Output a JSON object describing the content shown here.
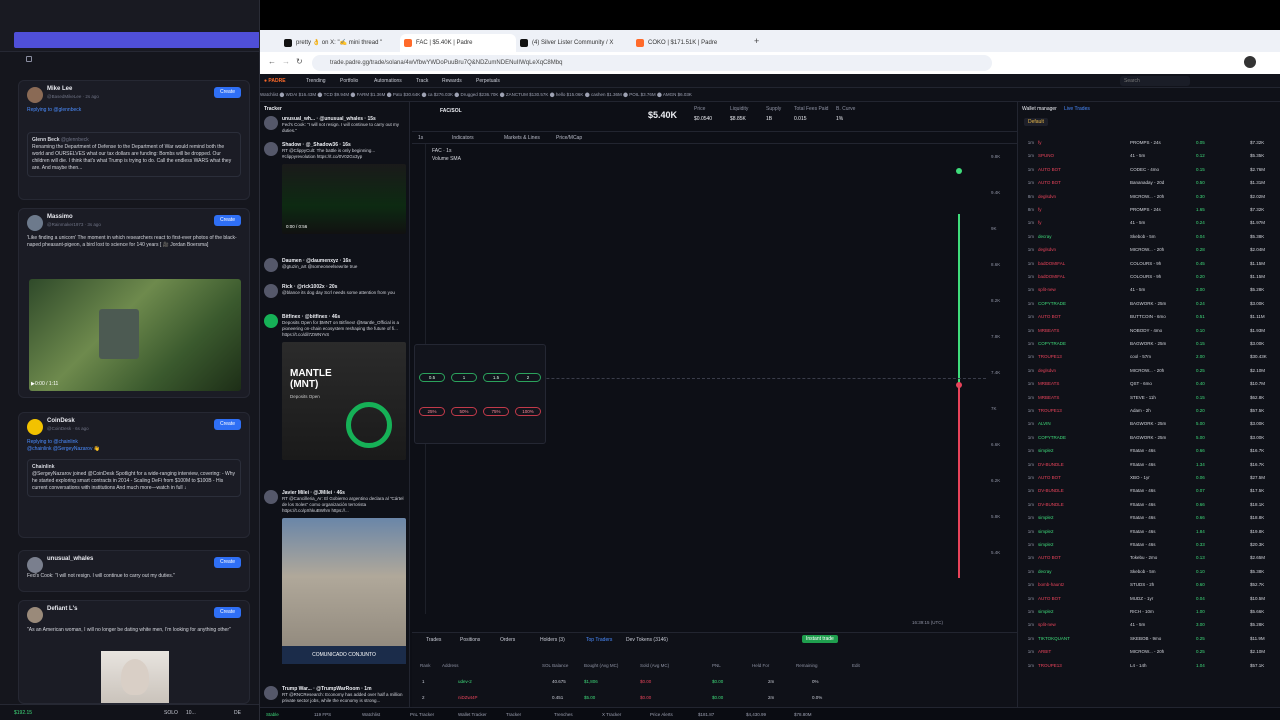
{
  "extension": {
    "posts": [
      {
        "name": "Mike Lee",
        "handle": "@BasedMikeLee · 2s ago",
        "reply": "Replying to @glennbeck",
        "quote_name": "Glenn Beck",
        "quote_handle": "@glennbeck",
        "quote_text": "Renaming the Department of Defense to the Department of War would remind both the world and OURSELVES what our tax dollars are funding: Bombs will be dropped. Our children will die. I think that's what Trump is trying to do. Call the endless WARS what they are. And maybe then..."
      },
      {
        "name": "Massimo",
        "handle": "@Rainmaker1973 · 3s ago",
        "text": "'Like finding a unicorn' The moment in which researchers react to first-ever photos of the black-naped pheasant-pigeon, a bird lost to science for 140 years [ 🎥 Jordan Boersma]",
        "video_time": "0:00 / 1:11"
      },
      {
        "name": "CoinDesk",
        "handle": "@CoinDesk · 6s ago",
        "reply": "Replying to @chainlink",
        "mention": "@chainlink @SergeyNazarov 👋",
        "quote_name": "Chainlink",
        "quote_text": "@SergeyNazarov joined @CoinDesk Spotlight for a wide-ranging interview, covering: - Why he started exploring smart contracts in 2014 - Scaling DeFi from $100M to $100B - His current conversations with institutions And much more—watch in full ↓"
      },
      {
        "name": "unusual_whales",
        "handle": "@unusual_whales · 8s ago",
        "text": "Fed's Cook: \"I will not resign. I will continue to carry out my duties.\""
      },
      {
        "name": "Defiant L's",
        "handle": "@DefiantLs · 9s ago",
        "text": "\"As an American woman, I will no longer be dating white men, I'm looking for anything other\""
      }
    ],
    "create_label": "Create",
    "footer": {
      "balance": "$192.15",
      "sol": "SOLO",
      "amount": "10...",
      "lang": "DE"
    }
  },
  "browser": {
    "tabs": [
      {
        "title": "pretty 👌 on X: \"✍️ mini thread \"",
        "color": "#111111"
      },
      {
        "title": "FAC | $5.40K | Padre",
        "color": "#ff6a2a"
      },
      {
        "title": "(4) Silver Lister Community / X",
        "color": "#111111"
      },
      {
        "title": "COKO | $171.51K | Padre",
        "color": "#ff6a2a"
      }
    ],
    "url": "trade.padre.gg/trade/solana/4wVfbwYWDoPuuBru7Q&NDZumNDENuIIWqLeXqC8Mbq"
  },
  "app": {
    "nav": [
      "Trending",
      "Portfolio",
      "Automations",
      "Track",
      "Rewards",
      "Perpetuals"
    ],
    "search_placeholder": "Search",
    "ticker": "Watchlist  ⬤ WDAI $16.43M  ⬤ TCD $9.94M  ⬤ FARM $1.36M  ⬤ Pato $30.64K  ⬤ ca $276.03K  ⬤ Drugged $236.70K  ⬤ ZANCTUM $130.57K  ⬤ hello $15.06K  ⬤ cashen $1.36M  ⬤ POIL $3.76M  ⬤ AMGN $6.03K",
    "tracker_title": "Tracker",
    "tweets": [
      {
        "name": "unusual_wh... · @unusual_whales · 15s",
        "text": "Fed's Cook: \"I will not resign. I will continue to carry out my duties.\""
      },
      {
        "name": "Shadow · @_Shadow36 · 16s",
        "text": "RT @ClippyCult: The battle is only beginning... #clippyrevolution https://t.co/0V02Gx3yp",
        "video": "0:00 / 0:56"
      },
      {
        "name": "Daumen · @daumenxyz · 16s",
        "text": "@gtuzin_art @someoneelsewrite true"
      },
      {
        "name": "Rick · @rick1002x · 20s",
        "text": "@blance its dog day Scrl needs some attention from you"
      },
      {
        "name": "Bitfinex · @bitfinex · 46s",
        "text": "Deposits Open for $MNT on Bitfinex! @Mantle_Official is a pioneering on-chain ecosystem reshaping the future of fi... https://t.co/dil7ZWNYvS",
        "image_text": "MANTLE (MNT)",
        "image_sub": "Deposits Open"
      },
      {
        "name": "Javier Milei · @JMilei · 46s",
        "text": "RT @Cancilleria_Ar: El Gobierno argentino declara al \"Cártel de los Soles\" como organización terrorista https://t.co/pXhkuBWhm https://...",
        "image_text": "COMUNICADO CONJUNTO"
      },
      {
        "name": "Trump War... · @TrumpWarRoom · 1m",
        "text": "RT @RNCResearch: Economy has added over half a million private sector jobs, while the economy is strong..."
      }
    ],
    "token": {
      "pair": "FAC/SOL",
      "name": "FAC",
      "price": "$5.40K",
      "price_label": "Price",
      "price_val": "$0.0540",
      "liquidity_label": "Liquidity",
      "liquidity": "$8.85K",
      "supply_label": "Supply",
      "supply": "1B",
      "fees_label": "Total Fees Paid",
      "fees": "0.015",
      "curve_label": "B. Curve",
      "curve": "1%"
    },
    "chart_toolbar": [
      "1s",
      "Indicators",
      "Markets & Lines",
      "Price/MCap"
    ],
    "chart_label": "FAC · 1s",
    "volume_label": "Volume SMA",
    "y_ticks": [
      "9.8K",
      "9.4K",
      "9K",
      "8.6K",
      "8.2K",
      "7.8K",
      "7.4K",
      "7K",
      "6.6K",
      "6.2K",
      "5.8K",
      "5.4K"
    ],
    "time_label": "16:39:15 (UTC)",
    "bottom_tabs": [
      "Trades",
      "Positions",
      "Orders",
      "Holders (3)",
      "Top Traders",
      "Dev Tokens (3146)"
    ],
    "bottom_cols": [
      "Rank",
      "Address",
      "SOL Balance",
      "Bought (Avg MC)",
      "Sold (Avg MC)",
      "PNL",
      "Held For",
      "Remaining",
      "Edit"
    ],
    "bottom_rows": [
      {
        "rank": "1",
        "addr": "udev-2",
        "bal": "40.675",
        "bought": "$1,806",
        "sold": "$0.00",
        "pnl": "$0.00",
        "held": "2m",
        "rem": "0%"
      },
      {
        "rank": "2",
        "addr": "niDZwt4P",
        "bal": "0.451",
        "bought": "$5.00",
        "sold": "$0.00",
        "pnl": "$0.00",
        "held": "2m",
        "rem": "0.0%"
      }
    ],
    "instant_trade": "Instant trade",
    "wallet_manager": "Wallet manager",
    "live_trades": "Live Trades",
    "default_label": "Default",
    "trade_rows": [
      {
        "n": "1m",
        "w": "fy",
        "t": "PROMPS - 24s",
        "a": "0.05",
        "m": "$7.32K"
      },
      {
        "n": "1m",
        "w": "SPUNO",
        "t": "41 - 5m",
        "a": "0.12",
        "m": "$5.35K"
      },
      {
        "n": "1m",
        "w": "AUTO BOT",
        "t": "CODEC - 4mo",
        "a": "0.15",
        "m": "$2.76M"
      },
      {
        "n": "1m",
        "w": "AUTO BOT",
        "t": "Bananaday - 20d",
        "a": "0.50",
        "m": "$1.31M"
      },
      {
        "n": "8m",
        "w": "deglsdvn",
        "t": "MICROW... - 20h",
        "a": "0.30",
        "m": "$2.02M"
      },
      {
        "n": "8m",
        "w": "fy",
        "t": "PROMPS - 24s",
        "a": "1.65",
        "m": "$7.32K"
      },
      {
        "n": "1m",
        "w": "fy",
        "t": "41 - 5m",
        "a": "0.24",
        "m": "$1.97M"
      },
      {
        "n": "1m",
        "w": "decray",
        "t": "Skebob - 5m",
        "a": "0.04",
        "m": "$5.38K"
      },
      {
        "n": "1m",
        "w": "deglsdvn",
        "t": "MICROW... - 20h",
        "a": "0.28",
        "m": "$2.04M"
      },
      {
        "n": "1m",
        "w": "badDOMIFAL",
        "t": "COLOURS - 9h",
        "a": "0.45",
        "m": "$1.15M"
      },
      {
        "n": "1m",
        "w": "badDOMIFAL",
        "t": "COLOURS - 9h",
        "a": "0.20",
        "m": "$1.15M"
      },
      {
        "n": "1m",
        "w": "split-new",
        "t": "41 - 5m",
        "a": "3.00",
        "m": "$5.28K"
      },
      {
        "n": "1m",
        "w": "COPYTRADE",
        "t": "BAGWORK - 25m",
        "a": "0.24",
        "m": "$3.00K"
      },
      {
        "n": "1m",
        "w": "AUTO BOT",
        "t": "BUTTCOIN - 6mo",
        "a": "0.51",
        "m": "$1.11M"
      },
      {
        "n": "1m",
        "w": "MRBEATS",
        "t": "NOBODY - 4mo",
        "a": "0.10",
        "m": "$1.93M"
      },
      {
        "n": "1m",
        "w": "COPYTRADE",
        "t": "BAGWORK - 25m",
        "a": "0.15",
        "m": "$3.00K"
      },
      {
        "n": "1m",
        "w": "TROUPE13",
        "t": "cool - 57m",
        "a": "2.00",
        "m": "$30.43K"
      },
      {
        "n": "1m",
        "w": "deglsdvn",
        "t": "MICROW... - 20h",
        "a": "0.25",
        "m": "$2.10M"
      },
      {
        "n": "1m",
        "w": "MRBEATS",
        "t": "QST - 6mo",
        "a": "0.40",
        "m": "$10.7M"
      },
      {
        "n": "1m",
        "w": "MRBEATS",
        "t": "STEVE - 11h",
        "a": "0.15",
        "m": "$62.8K"
      },
      {
        "n": "1m",
        "w": "TROUPE13",
        "t": "Adam - 2h",
        "a": "0.20",
        "m": "$57.5K"
      },
      {
        "n": "1m",
        "w": "ALVIN",
        "t": "BAGWORK - 25m",
        "a": "5.00",
        "m": "$3.00K"
      },
      {
        "n": "1m",
        "w": "COPYTRADE",
        "t": "BAGWORK - 25m",
        "a": "5.00",
        "m": "$3.00K"
      },
      {
        "n": "1m",
        "w": "simple2",
        "t": "#Satan - 46s",
        "a": "0.66",
        "m": "$16.7K"
      },
      {
        "n": "1m",
        "w": "DV-BUNDLE",
        "t": "#Satan - 46s",
        "a": "1.34",
        "m": "$16.7K"
      },
      {
        "n": "1m",
        "w": "AUTO BOT",
        "t": "XBO - 1yr",
        "a": "0.06",
        "m": "$27.5M"
      },
      {
        "n": "1m",
        "w": "DV-BUNDLE",
        "t": "#Satan - 46s",
        "a": "0.07",
        "m": "$17.5K"
      },
      {
        "n": "1m",
        "w": "DV-BUNDLE",
        "t": "#Satan - 46s",
        "a": "0.66",
        "m": "$18.1K"
      },
      {
        "n": "1m",
        "w": "simple2",
        "t": "#Satan - 46s",
        "a": "0.66",
        "m": "$18.8K"
      },
      {
        "n": "1m",
        "w": "simple2",
        "t": "#Satan - 46s",
        "a": "1.84",
        "m": "$19.8K"
      },
      {
        "n": "1m",
        "w": "simple2",
        "t": "#Satan - 46s",
        "a": "0.33",
        "m": "$20.3K"
      },
      {
        "n": "1m",
        "w": "AUTO BOT",
        "t": "Tokebu - 2mo",
        "a": "0.13",
        "m": "$2.65M"
      },
      {
        "n": "1m",
        "w": "decray",
        "t": "Skebob - 5m",
        "a": "0.10",
        "m": "$5.38K"
      },
      {
        "n": "1m",
        "w": "bomb-hauntz",
        "t": "STUDS - 2h",
        "a": "0.60",
        "m": "$52.7K"
      },
      {
        "n": "1m",
        "w": "AUTO BOT",
        "t": "MUDZ - 1yr",
        "a": "0.04",
        "m": "$10.5M"
      },
      {
        "n": "1m",
        "w": "simple2",
        "t": "RICH - 10m",
        "a": "1.00",
        "m": "$5.66K"
      },
      {
        "n": "1m",
        "w": "split-new",
        "t": "41 - 5m",
        "a": "3.00",
        "m": "$5.28K"
      },
      {
        "n": "1m",
        "w": "TIKTOKQUANT",
        "t": "SKEBOB - 9mo",
        "a": "0.25",
        "m": "$11.9M"
      },
      {
        "n": "1m",
        "w": "ARBIT",
        "t": "MICROW... - 20h",
        "a": "0.25",
        "m": "$2.10M"
      },
      {
        "n": "1m",
        "w": "TROUPE13",
        "t": "L4 - 14h",
        "a": "1.04",
        "m": "$57.1K"
      }
    ],
    "status": [
      "Stable",
      "119 FPS",
      "Watchlist",
      "PnL Tracker",
      "Wallet Tracker",
      "Tracker",
      "Trenches",
      "X Tracker",
      "Price Alerts",
      "$181.87",
      "$4,430.99",
      "$78.80M"
    ]
  }
}
